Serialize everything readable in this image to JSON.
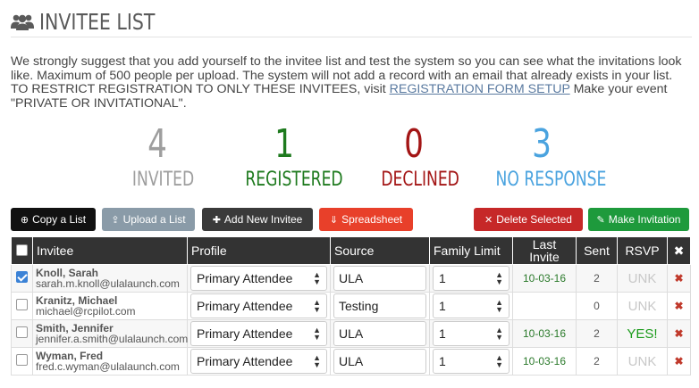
{
  "header": {
    "title": "INVITEE LIST",
    "icon": "users-icon"
  },
  "intro": {
    "text_before": "We strongly suggest that you add yourself to the invitee list and test the system so you can see what the invitations look like. Maximum of 500 people per upload. The system will not add a record with an email that already exists in your list. TO RESTRICT REGISTRATION TO ONLY THESE INVITEES, visit ",
    "link_text": "REGISTRATION FORM SETUP",
    "text_after": " Make your event \"PRIVATE OR INVITATIONAL\"."
  },
  "stats": {
    "invited": {
      "value": "4",
      "label": "INVITED",
      "color": "#9e9e9e"
    },
    "registered": {
      "value": "1",
      "label": "REGISTERED",
      "color": "#1e7a1e"
    },
    "declined": {
      "value": "0",
      "label": "DECLINED",
      "color": "#a31515"
    },
    "no_response": {
      "value": "3",
      "label": "NO RESPONSE",
      "color": "#4aa3df"
    }
  },
  "toolbar": {
    "copy": "Copy a List",
    "upload": "Upload a List",
    "add": "Add New Invitee",
    "spreadsheet": "Spreadsheet",
    "delete": "Delete Selected",
    "make": "Make Invitation"
  },
  "table": {
    "headers": [
      "Invitee",
      "Profile",
      "Source",
      "Family Limit",
      "Last Invite",
      "Sent",
      "RSVP"
    ],
    "rows": [
      {
        "name": "Knoll, Sarah",
        "email": "sarah.m.knoll@ulalaunch.com",
        "checked": true,
        "profile": "Primary Attendee",
        "source": "ULA",
        "family_limit": "1",
        "last_invite": "10-03-16",
        "sent": "2",
        "rsvp": "UNK"
      },
      {
        "name": "Kranitz, Michael",
        "email": "michael@rcpilot.com",
        "checked": false,
        "profile": "Primary Attendee",
        "source": "Testing",
        "family_limit": "1",
        "last_invite": "",
        "sent": "0",
        "rsvp": "UNK"
      },
      {
        "name": "Smith, Jennifer",
        "email": "jennifer.a.smith@ulalaunch.com",
        "checked": false,
        "profile": "Primary Attendee",
        "source": "ULA",
        "family_limit": "1",
        "last_invite": "10-03-16",
        "sent": "2",
        "rsvp": "YES!"
      },
      {
        "name": "Wyman, Fred",
        "email": "fred.c.wyman@ulalaunch.com",
        "checked": false,
        "profile": "Primary Attendee",
        "source": "ULA",
        "family_limit": "1",
        "last_invite": "10-03-16",
        "sent": "2",
        "rsvp": "UNK"
      }
    ]
  },
  "colors": {
    "black_btn": "#111111",
    "gray_btn": "#8a9ba8",
    "dark_btn": "#3a3a3a",
    "red_btn": "#e8402a",
    "darkred_btn": "#c62828",
    "green_btn": "#1e9a3c"
  }
}
